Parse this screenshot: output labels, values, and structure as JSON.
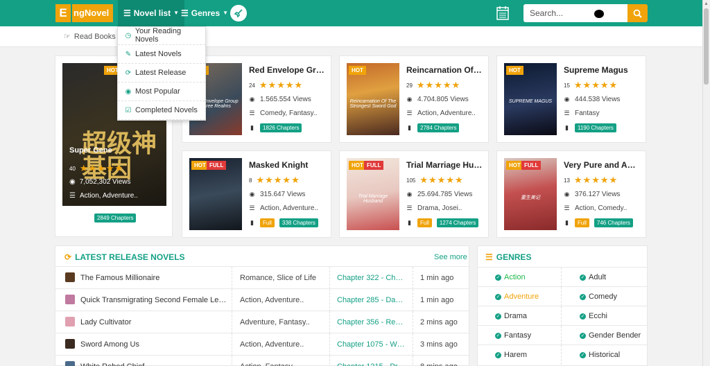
{
  "header": {
    "logo_letter": "E",
    "logo_text": "ngNovel",
    "nav_novel_list": "Novel list",
    "nav_genres": "Genres",
    "search_placeholder": "Search..."
  },
  "breadcrumb": {
    "text": "Read Books O"
  },
  "dropdown": {
    "items": [
      {
        "label": "Your Reading Novels",
        "icon": "clock-icon"
      },
      {
        "label": "Latest Novels",
        "icon": "edit-icon"
      },
      {
        "label": "Latest Release",
        "icon": "refresh-icon"
      },
      {
        "label": "Most Popular",
        "icon": "eye-icon"
      },
      {
        "label": "Completed Novels",
        "icon": "check-square-icon"
      }
    ]
  },
  "featured": {
    "title": "Super Gene",
    "rating_count": "40",
    "views": "7,052,302 Views",
    "genres": "Action, Adventure..",
    "chapters": "2849 Chapters",
    "cover_text": "超级神基因"
  },
  "novels": [
    {
      "title": "Red Envelope Group ...",
      "rating": "24",
      "views": "1.565.554 Views",
      "genres": "Comedy, Fantasy..",
      "chapters": "1826 Chapters",
      "full": false,
      "cover_text": "Red Envelope Group Three Realms"
    },
    {
      "title": "Reincarnation Of The...",
      "rating": "29",
      "views": "4.704.805 Views",
      "genres": "Action, Adventure..",
      "chapters": "2784 Chapters",
      "full": false,
      "cover_text": "Reincarnation Of The Strongest Sword God"
    },
    {
      "title": "Supreme Magus",
      "rating": "15",
      "views": "444.538 Views",
      "genres": "Fantasy",
      "chapters": "1190 Chapters",
      "full": false,
      "cover_text": "SUPREME MAGUS"
    },
    {
      "title": "Masked Knight",
      "rating": "8",
      "views": "315.647 Views",
      "genres": "Action, Adventure..",
      "chapters": "338 Chapters",
      "full": true,
      "full_label": "Full",
      "cover_text": ""
    },
    {
      "title": "Trial Marriage Husba...",
      "rating": "105",
      "views": "25.694.785 Views",
      "genres": "Drama, Josei..",
      "chapters": "1274 Chapters",
      "full": true,
      "full_label": "Full",
      "cover_text": "Trial Marriage Husband"
    },
    {
      "title": "Very Pure and Ambig...",
      "rating": "13",
      "views": "376.127 Views",
      "genres": "Action, Comedy..",
      "chapters": "746 Chapters",
      "full": true,
      "full_label": "Full",
      "cover_text": "重生美记"
    }
  ],
  "badges": {
    "hot": "HOT",
    "full": "FULL"
  },
  "latest": {
    "heading": "LATEST RELEASE NOVELS",
    "see_more": "See more",
    "rows": [
      {
        "title": "The Famous Millionaire",
        "genres": "Romance, Slice of Life",
        "chapter": "Chapter 322 - Chapt...",
        "time": "1 min ago"
      },
      {
        "title": "Quick Transmigrating Second Female Lead'...",
        "genres": "Action, Adventure..",
        "chapter": "Chapter 285 - Daugh...",
        "time": "1 min ago"
      },
      {
        "title": "Lady Cultivator",
        "genres": "Adventure, Fantasy..",
        "chapter": "Chapter 356 - Rentin...",
        "time": "2 mins ago"
      },
      {
        "title": "Sword Among Us",
        "genres": "Action, Adventure..",
        "chapter": "Chapter 1075 - Work...",
        "time": "3 mins ago"
      },
      {
        "title": "White Robed Chief",
        "genres": "Action, Fantasy..",
        "chapter": "Chapter 1215 - Prep...",
        "time": "8 mins ago"
      }
    ]
  },
  "genres": {
    "heading": "GENRES",
    "rows": [
      [
        "Action",
        "Adult"
      ],
      [
        "Adventure",
        "Comedy"
      ],
      [
        "Drama",
        "Ecchi"
      ],
      [
        "Fantasy",
        "Gender Bender"
      ],
      [
        "Harem",
        "Historical"
      ]
    ]
  },
  "colors": {
    "accent": "#14a085",
    "orange": "#f0a30a",
    "red": "#e03a3a"
  }
}
